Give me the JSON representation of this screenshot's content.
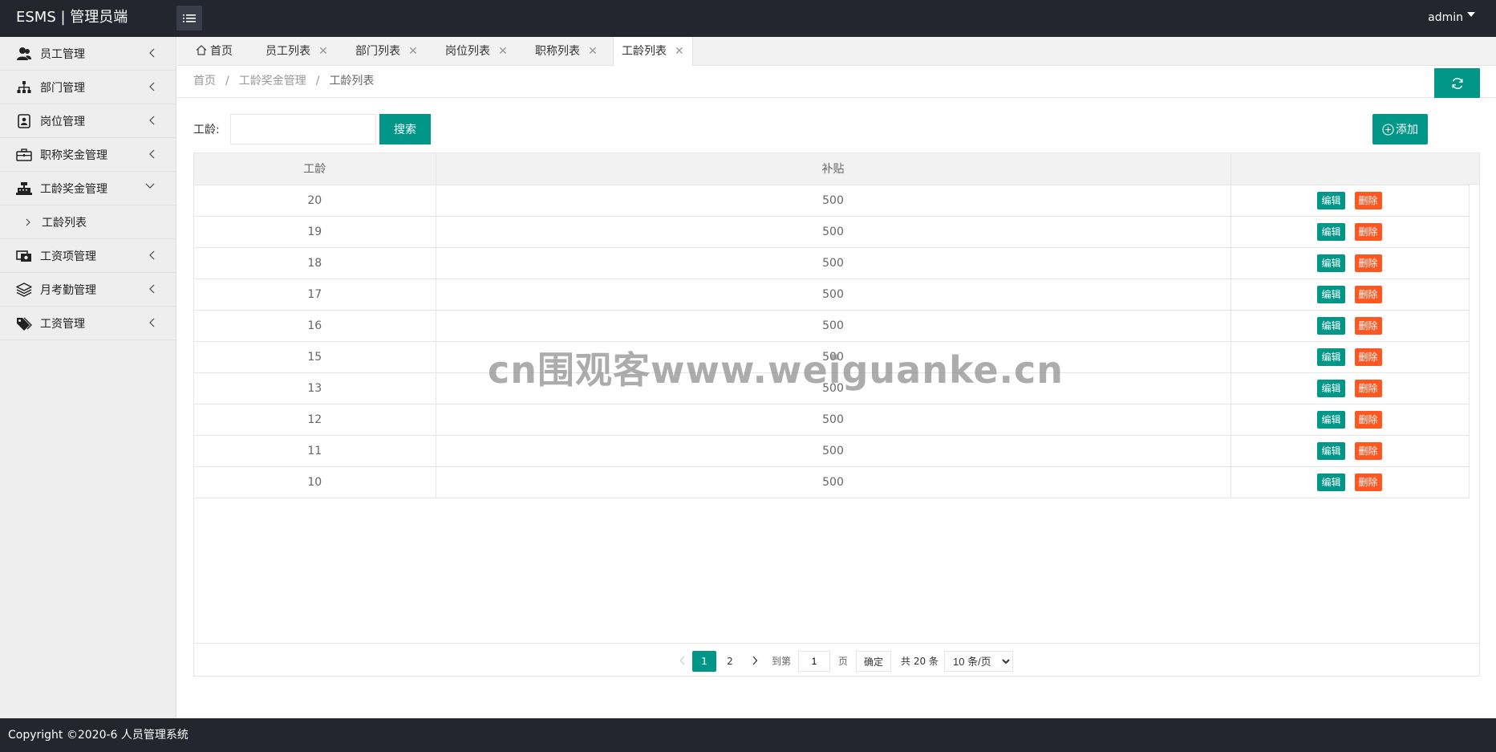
{
  "header": {
    "brand": "ESMS | 管理员端",
    "user": "admin"
  },
  "sidebar": {
    "items": [
      {
        "label": "员工管理",
        "icon": "users-icon"
      },
      {
        "label": "部门管理",
        "icon": "sitemap-icon"
      },
      {
        "label": "岗位管理",
        "icon": "id-card-icon"
      },
      {
        "label": "职称奖金管理",
        "icon": "briefcase-icon"
      },
      {
        "label": "工龄奖金管理",
        "icon": "cash-register-icon"
      },
      {
        "label": "工资项管理",
        "icon": "money-icon"
      },
      {
        "label": "月考勤管理",
        "icon": "layers-icon"
      },
      {
        "label": "工资管理",
        "icon": "tags-icon"
      }
    ],
    "sub_items": [
      {
        "label": "工龄列表"
      }
    ]
  },
  "tabs": [
    {
      "label": "首页"
    },
    {
      "label": "员工列表"
    },
    {
      "label": "部门列表"
    },
    {
      "label": "岗位列表"
    },
    {
      "label": "职称列表"
    },
    {
      "label": "工龄列表"
    }
  ],
  "breadcrumb": {
    "home": "首页",
    "section": "工龄奖金管理",
    "current": "工龄列表"
  },
  "search": {
    "label": "工龄:",
    "value": "",
    "button": "搜索"
  },
  "add_button": "添加",
  "table": {
    "columns": [
      "工龄",
      "补贴",
      ""
    ],
    "edit_label": "编辑",
    "delete_label": "删除",
    "rows": [
      {
        "years": "20",
        "subsidy": "500"
      },
      {
        "years": "19",
        "subsidy": "500"
      },
      {
        "years": "18",
        "subsidy": "500"
      },
      {
        "years": "17",
        "subsidy": "500"
      },
      {
        "years": "16",
        "subsidy": "500"
      },
      {
        "years": "15",
        "subsidy": "500"
      },
      {
        "years": "13",
        "subsidy": "500"
      },
      {
        "years": "12",
        "subsidy": "500"
      },
      {
        "years": "11",
        "subsidy": "500"
      },
      {
        "years": "10",
        "subsidy": "500"
      }
    ]
  },
  "pagination": {
    "current_page": "1",
    "next_page": "2",
    "goto_label": "到第",
    "goto_value": "1",
    "page_unit": "页",
    "confirm": "确定",
    "total": "共 20 条",
    "page_size": "10 条/页"
  },
  "watermark": "cn围观客www.weiguanke.cn",
  "footer": "Copyright ©2020-6 人员管理系统",
  "colors": {
    "header_bg": "#23262e",
    "accent": "#009688",
    "danger": "#ff5722",
    "sidebar_bg": "#eeeeee"
  }
}
